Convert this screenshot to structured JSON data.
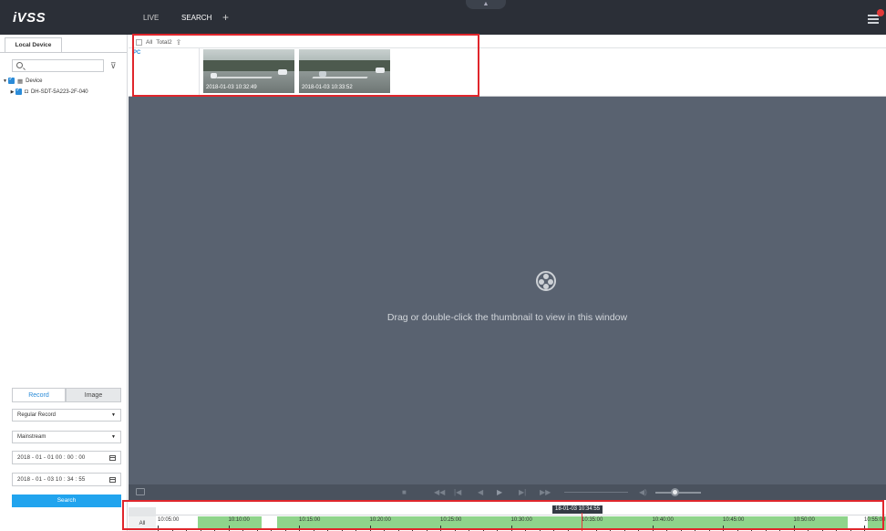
{
  "topbar": {
    "logo": "iVSS",
    "tabs": [
      {
        "label": "LIVE"
      },
      {
        "label": "SEARCH"
      }
    ],
    "add_tab": "+",
    "collapse_handle": "▲"
  },
  "left_panel": {
    "device_tab": "Local Device",
    "search_placeholder": "",
    "tree": {
      "root_label": "Device",
      "child_label": "DH-SDT-5A223-2F-040"
    },
    "mode_tabs": [
      {
        "label": "Record"
      },
      {
        "label": "Image"
      }
    ],
    "record_type": "Regular Record",
    "stream": "Mainstream",
    "start_time": "2018 - 01 - 01  00 : 00 : 00",
    "end_time": "2018 - 01 - 03  10 : 34 : 55",
    "search_button": "Search"
  },
  "results": {
    "select_all": "All",
    "total": "Total2",
    "channel_label": "PC",
    "thumbnails": [
      {
        "timestamp": "2018-01-03 10:32:49"
      },
      {
        "timestamp": "2018-01-03 10:33:52"
      }
    ]
  },
  "video": {
    "hint": "Drag or double-click the thumbnail to view in this window"
  },
  "timeline": {
    "all_label": "All",
    "current_time": "18-01-03 10:34:55",
    "labels": [
      "10:05:00",
      "10:10:00",
      "10:15:00",
      "10:20:00",
      "10:25:00",
      "10:30:00",
      "10:35:00",
      "10:40:00",
      "10:45:00",
      "10:50:00",
      "10:55:00"
    ]
  },
  "colors": {
    "accent": "#21a4ee",
    "highlight": "#e0262c",
    "record_green": "#8fd48b",
    "video_bg": "#596270",
    "topbar_bg": "#2b2f37"
  }
}
